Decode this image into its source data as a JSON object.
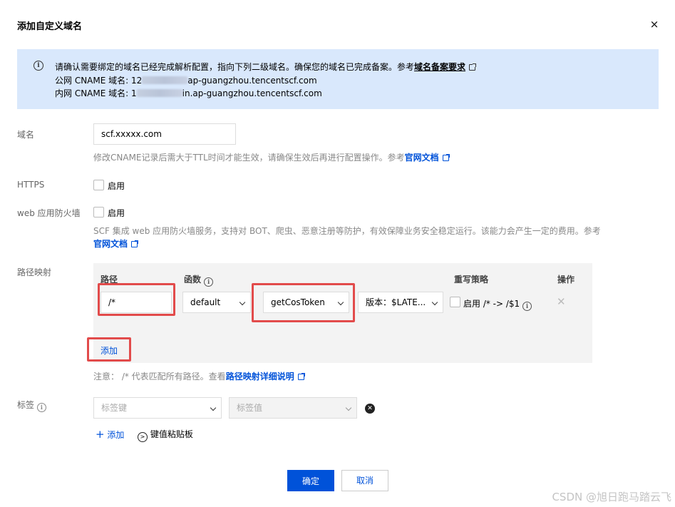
{
  "dialog": {
    "title": "添加自定义域名",
    "close_symbol": "×"
  },
  "notice": {
    "line1_text": "请确认需要绑定的域名已经完成解析配置，指向下列二级域名。确保您的域名已完成备案。参考",
    "line1_link": "域名备案要求",
    "line2_prefix": "公网 CNAME 域名: 12",
    "line2_suffix": "ap-guangzhou.tencentscf.com",
    "line3_prefix": "内网 CNAME 域名: 1",
    "line3_suffix": "in.ap-guangzhou.tencentscf.com"
  },
  "domain": {
    "label": "域名",
    "value": "scf.xxxxx.com",
    "hint": "修改CNAME记录后需大于TTL时间才能生效，请确保生效后再进行配置操作。参考",
    "hint_link": "官网文档"
  },
  "https": {
    "label": "HTTPS",
    "checkbox_label": "启用"
  },
  "waf": {
    "label": "web 应用防火墙",
    "checkbox_label": "启用",
    "hint": "SCF 集成 web 应用防火墙服务，支持对 BOT、爬虫、恶意注册等防护，有效保障业务安全稳定运行。该能力会产生一定的费用。参考",
    "hint_link": "官网文档"
  },
  "path_mapping": {
    "label": "路径映射",
    "headers": {
      "path": "路径",
      "function": "函数",
      "rewrite": "重写策略",
      "action": "操作"
    },
    "row": {
      "path_value": "/*",
      "namespace_value": "default",
      "function_value": "getCosToken",
      "version_value": "版本：$LATE...",
      "rewrite_label": "启用 /* -> /$1"
    },
    "add_label": "添加",
    "note_text": "注意： /* 代表匹配所有路径。查看",
    "note_link": "路径映射详细说明"
  },
  "tags": {
    "label": "标签",
    "key_placeholder": "标签键",
    "value_placeholder": "标签值",
    "add_label": "添加",
    "clipboard_label": "键值粘贴板"
  },
  "footer": {
    "confirm_label": "确定",
    "cancel_label": "取消"
  },
  "watermark": "CSDN @旭日跑马踏云飞",
  "colors": {
    "primary": "#0052d9",
    "notice_bg": "#d9e8fc",
    "highlight": "#e24b4b"
  }
}
